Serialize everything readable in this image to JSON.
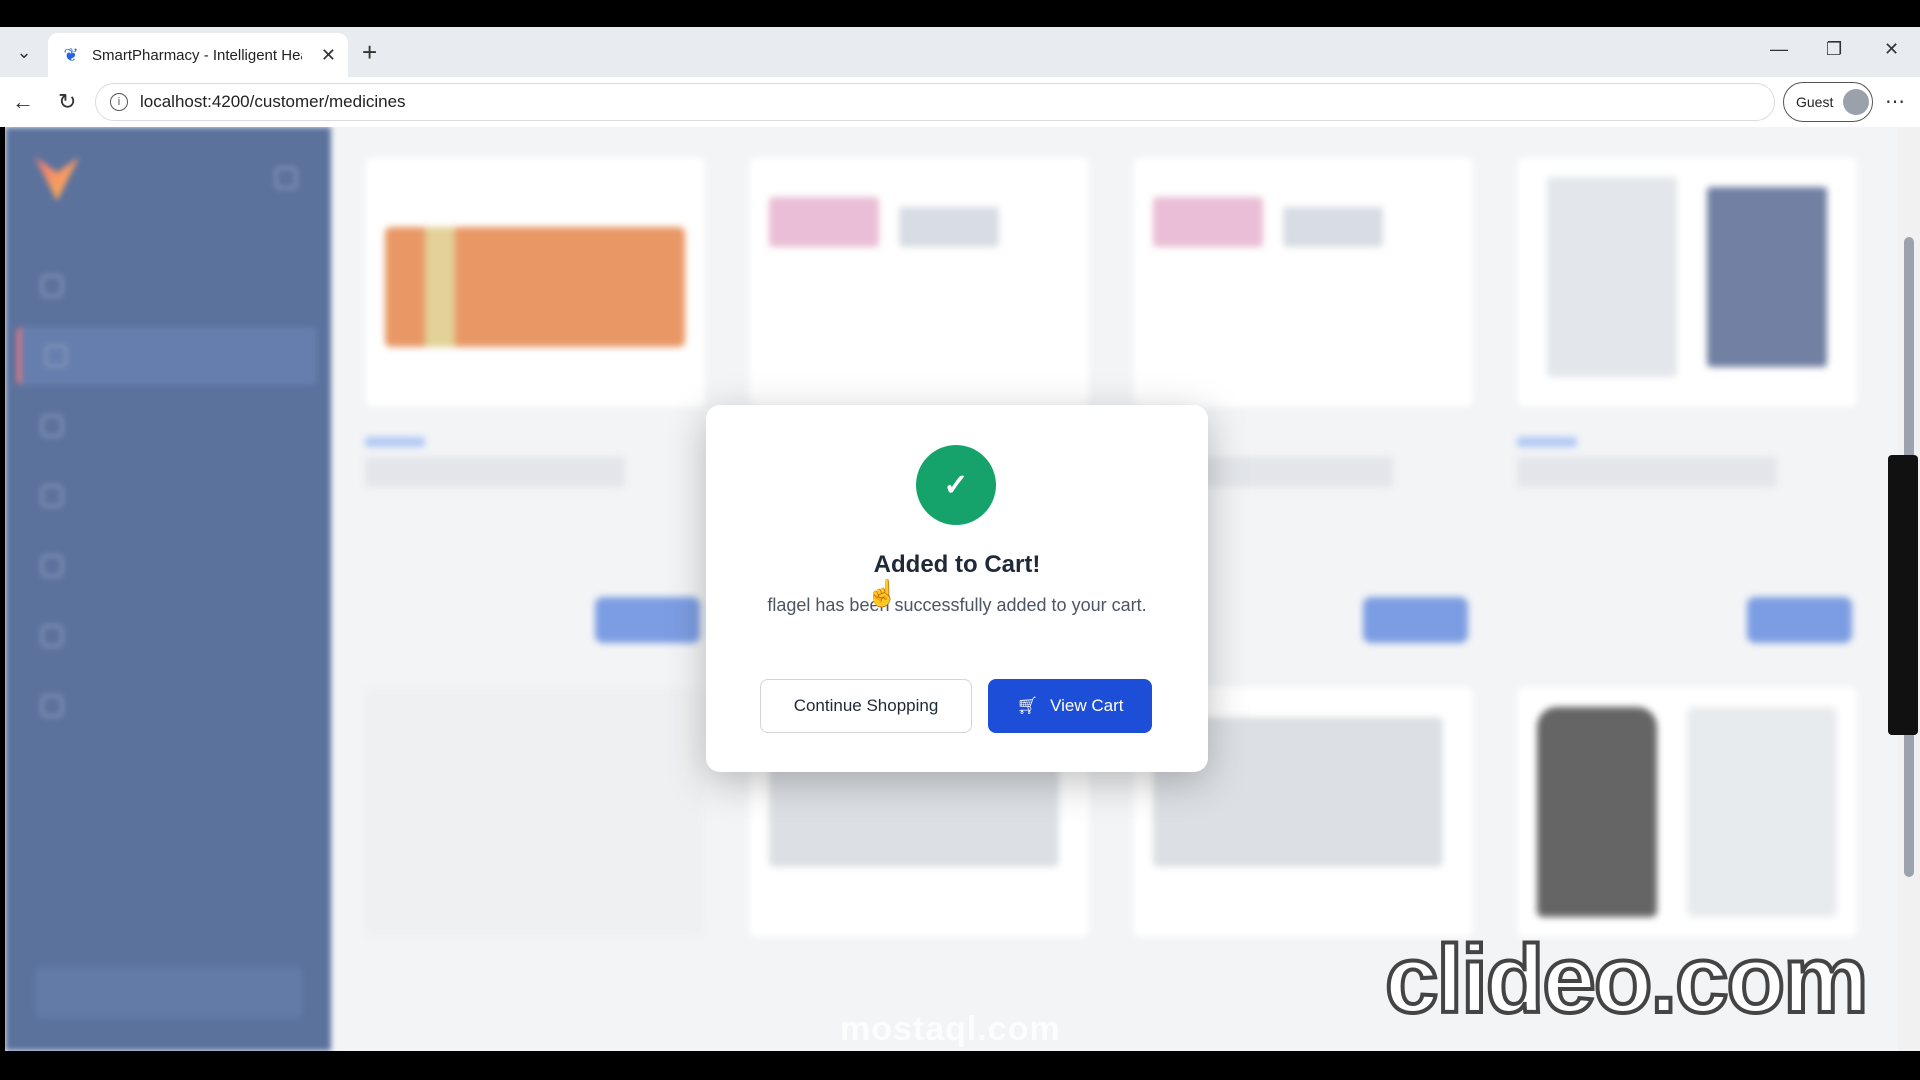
{
  "browser": {
    "tab_title": "SmartPharmacy - Intelligent Healt",
    "url": "localhost:4200/customer/medicines",
    "profile_label": "Guest"
  },
  "modal": {
    "title": "Added to Cart!",
    "message": "flagel has been successfully added to your cart.",
    "continue_label": "Continue Shopping",
    "view_cart_label": "View Cart"
  },
  "watermarks": {
    "clideo": "clideo.com",
    "mostaql": "mostaql.com"
  },
  "colors": {
    "sidebar": "#1c3c78",
    "success": "#16a36b",
    "primary": "#1d4ed8"
  }
}
